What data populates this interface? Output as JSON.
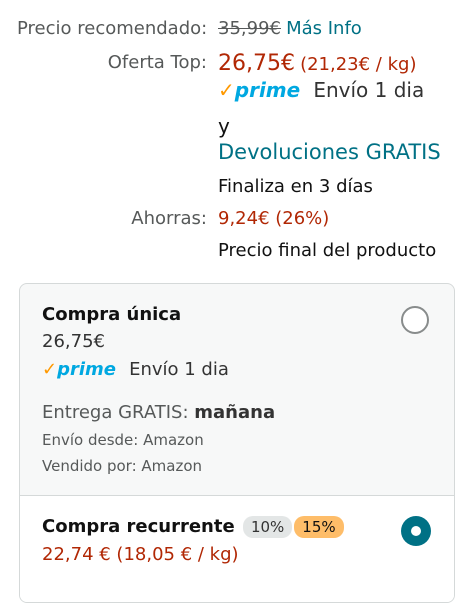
{
  "pricing": {
    "recommended_label": "Precio recomendado:",
    "recommended_value": "35,99€",
    "more_info_link": "Más Info",
    "offer_label": "Oferta Top:",
    "offer_price": "26,75€",
    "offer_unit_price": "(21,23€ / kg)",
    "prime_check": "✓",
    "prime_word": "prime",
    "shipping": "Envío 1 dia",
    "and_text": "y",
    "free_returns_link": "Devoluciones GRATIS",
    "ends_in": "Finaliza en 3 días",
    "savings_label": "Ahorras:",
    "savings_value": "9,24€ (26%)",
    "final_price_note": "Precio final del producto"
  },
  "purchase_options": {
    "one_time": {
      "title": "Compra única",
      "price": "26,75€",
      "prime_check": "✓",
      "prime_word": "prime",
      "shipping": "Envío 1 dia",
      "delivery_prefix": "Entrega GRATIS:",
      "delivery_day": "mañana",
      "ships_from": "Envío desde: Amazon",
      "sold_by": "Vendido por: Amazon"
    },
    "recurring": {
      "title": "Compra recurrente",
      "discount_a": "10%",
      "discount_b": "15%",
      "price": "22,74 € (18,05 € / kg)"
    }
  },
  "colors": {
    "price_red": "#B12704",
    "link_teal": "#007185",
    "prime_blue": "#00A8E1",
    "prime_orange": "#FF9900"
  }
}
